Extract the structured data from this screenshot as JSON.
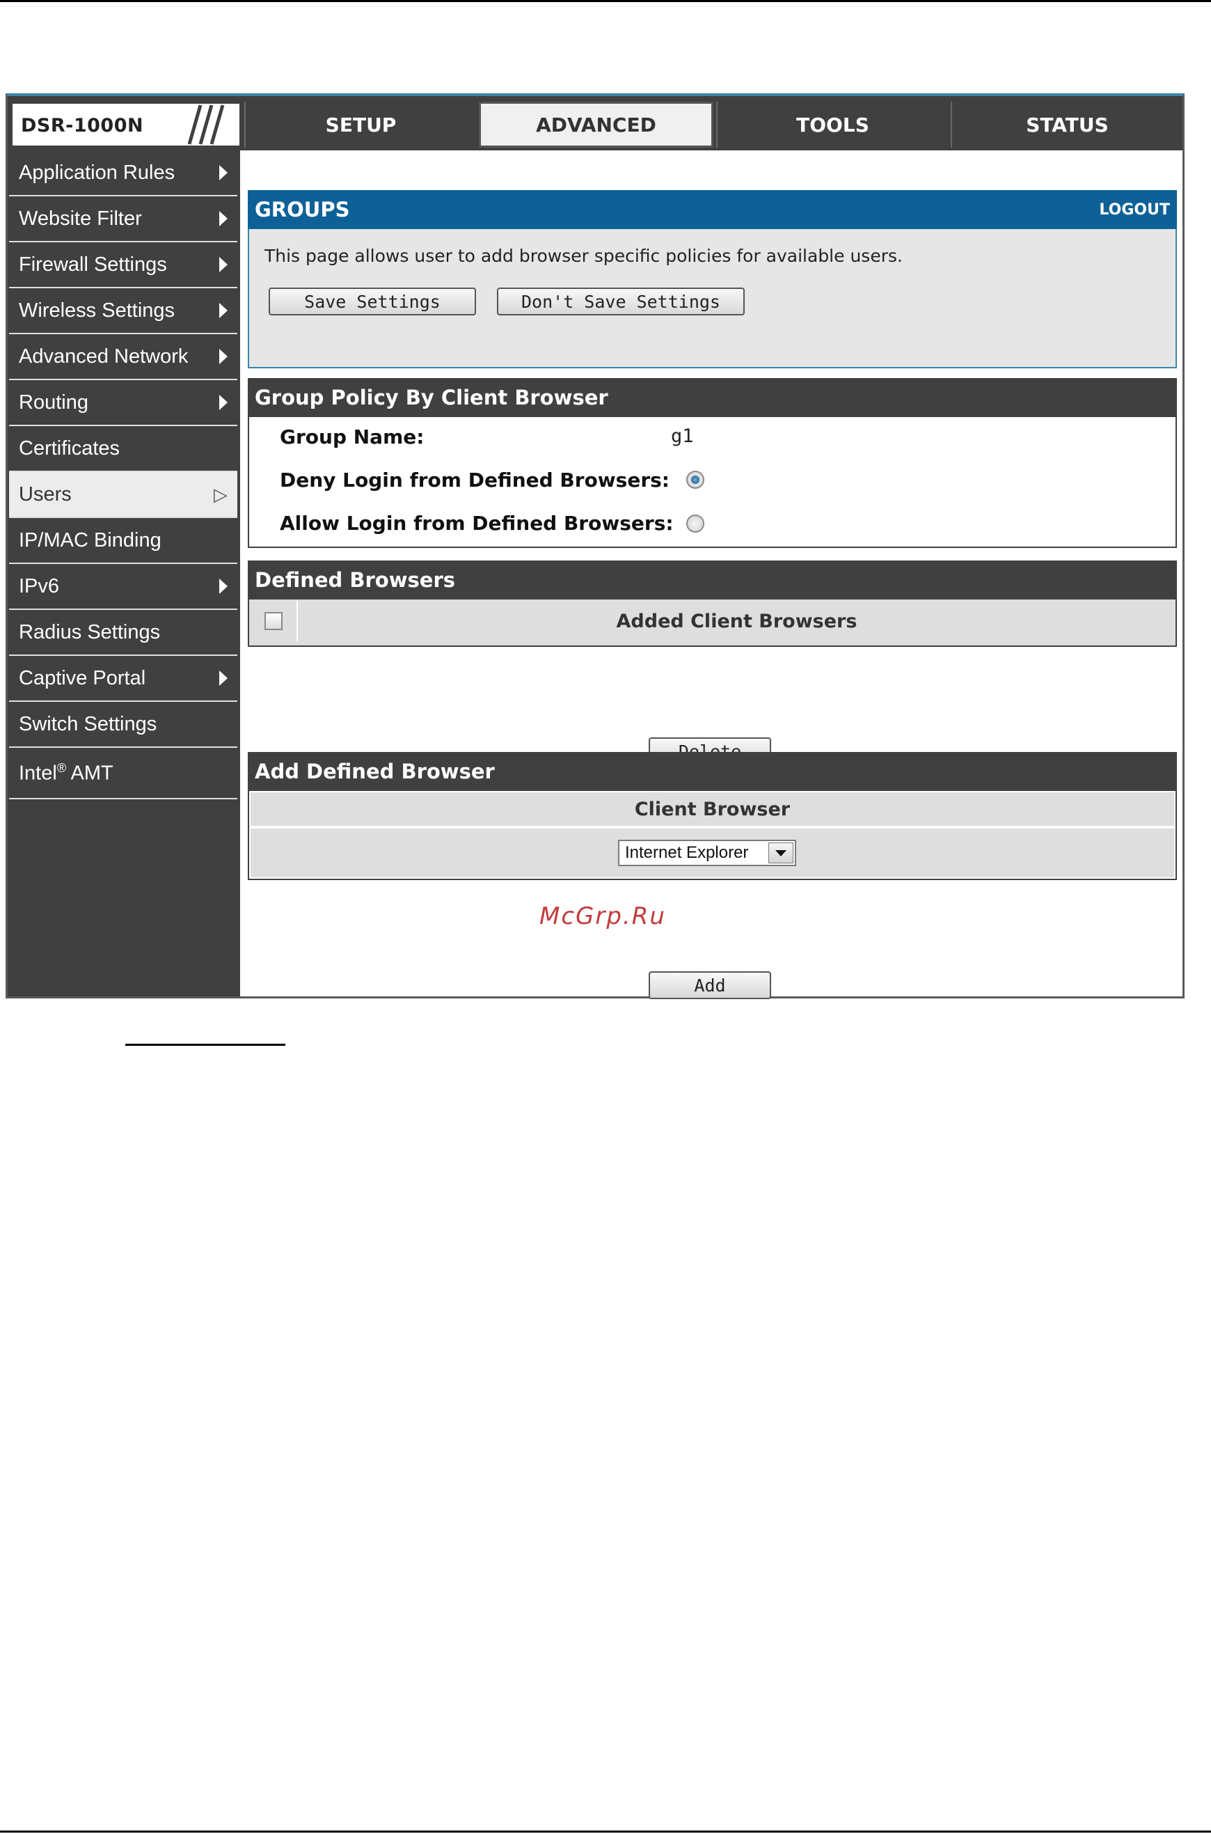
{
  "device": {
    "model": "DSR-1000N"
  },
  "tabs": [
    {
      "label": "SETUP"
    },
    {
      "label": "ADVANCED"
    },
    {
      "label": "TOOLS"
    },
    {
      "label": "STATUS"
    }
  ],
  "sidebar": {
    "items": [
      {
        "label": "Application Rules"
      },
      {
        "label": "Website Filter"
      },
      {
        "label": "Firewall Settings"
      },
      {
        "label": "Wireless Settings"
      },
      {
        "label": "Advanced Network"
      },
      {
        "label": "Routing"
      },
      {
        "label": "Certificates"
      },
      {
        "label": "Users"
      },
      {
        "label": "IP/MAC Binding"
      },
      {
        "label": "IPv6"
      },
      {
        "label": "Radius Settings"
      },
      {
        "label": "Captive Portal"
      },
      {
        "label": "Switch Settings"
      },
      {
        "label": "Intel",
        "sup": "®",
        "suffix": " AMT"
      }
    ]
  },
  "groups": {
    "title": "GROUPS",
    "logout": "LOGOUT",
    "description": "This page allows user to add browser specific policies for available users.",
    "save_label": "Save Settings",
    "dont_save_label": "Don't Save Settings"
  },
  "policy": {
    "title": "Group Policy By Client Browser",
    "group_name_label": "Group Name:",
    "group_name_value": "g1",
    "deny_label": "Deny Login from Defined Browsers:",
    "allow_label": "Allow Login from Defined Browsers:"
  },
  "defined": {
    "title": "Defined Browsers",
    "column_header": "Added Client Browsers",
    "delete_label": "Delete"
  },
  "add": {
    "title": "Add Defined Browser",
    "column_header": "Client Browser",
    "selected_browser": "Internet Explorer",
    "add_label": "Add"
  },
  "watermark": "McGrp.Ru"
}
